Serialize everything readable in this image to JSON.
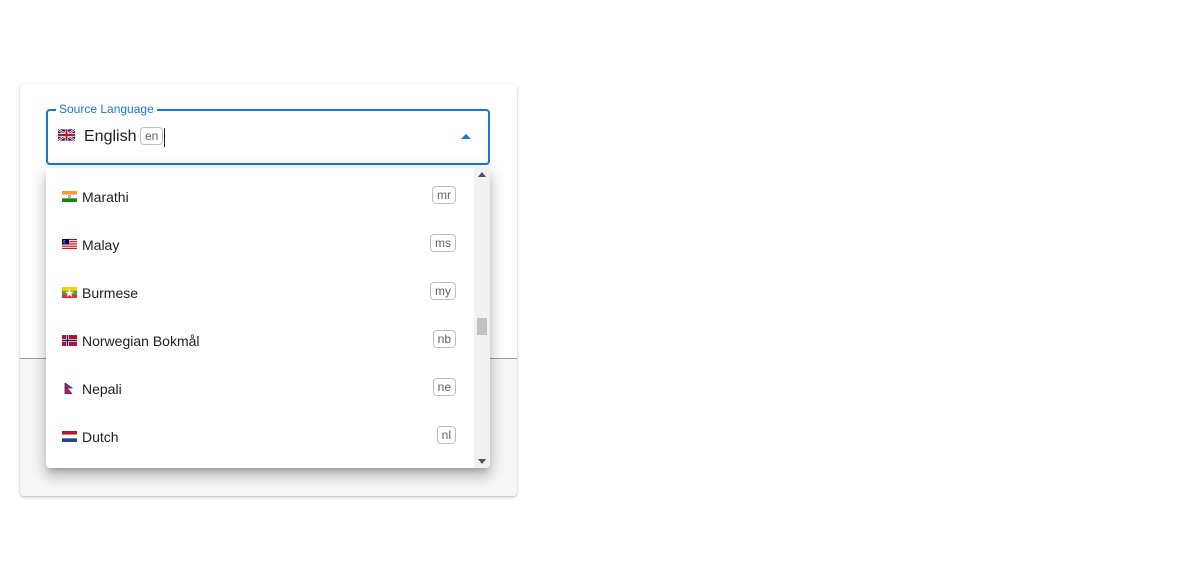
{
  "source_language": {
    "label": "Source Language",
    "value": "English",
    "code": "en",
    "flag_icon": "flag-gb-icon"
  },
  "dropdown": {
    "options": [
      {
        "label": "Marathi",
        "code": "mr",
        "flag_icon": "flag-in-icon"
      },
      {
        "label": "Malay",
        "code": "ms",
        "flag_icon": "flag-my-icon"
      },
      {
        "label": "Burmese",
        "code": "my",
        "flag_icon": "flag-mm-icon"
      },
      {
        "label": "Norwegian Bokmål",
        "code": "nb",
        "flag_icon": "flag-no-icon"
      },
      {
        "label": "Nepali",
        "code": "ne",
        "flag_icon": "flag-np-icon"
      },
      {
        "label": "Dutch",
        "code": "nl",
        "flag_icon": "flag-nl-icon"
      }
    ]
  },
  "colors": {
    "accent": "#1976d2",
    "text": "#212121",
    "chip_border": "#bdbdbd"
  }
}
